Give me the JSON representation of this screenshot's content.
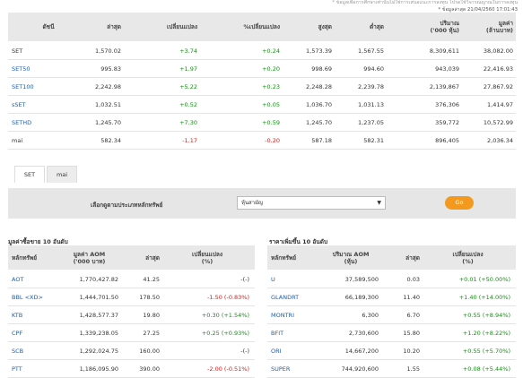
{
  "notes": {
    "line1": "* ข้อมูลเพื่อการศึกษาเท่านั้นไม่ใช่การเสนอแนะการลงทุน โปรดใช้วิจารณญาณในการลงทุน",
    "line2": "* ข้อมูลล่าสุด 21/04/2560 17:01:43"
  },
  "index_table": {
    "headers": [
      "ดัชนี",
      "ล่าสุด",
      "เปลี่ยนแปลง",
      "%เปลี่ยนแปลง",
      "สูงสุด",
      "ต่ำสุด",
      "ปริมาณ\n('000 หุ้น)",
      "มูลค่า\n(ล้านบาท)"
    ],
    "rows": [
      {
        "name": "SET",
        "last": "1,570.02",
        "chg": "+3.74",
        "pct": "+0.24",
        "high": "1,573.39",
        "low": "1,567.55",
        "vol": "8,309,611",
        "val": "38,082.00",
        "dir": "up",
        "link": false
      },
      {
        "name": "SET50",
        "last": "995.83",
        "chg": "+1.97",
        "pct": "+0.20",
        "high": "998.69",
        "low": "994.60",
        "vol": "943,039",
        "val": "22,416.93",
        "dir": "up",
        "link": true
      },
      {
        "name": "SET100",
        "last": "2,242.98",
        "chg": "+5.22",
        "pct": "+0.23",
        "high": "2,248.28",
        "low": "2,239.78",
        "vol": "2,139,867",
        "val": "27,867.92",
        "dir": "up",
        "link": true
      },
      {
        "name": "sSET",
        "last": "1,032.51",
        "chg": "+0.52",
        "pct": "+0.05",
        "high": "1,036.70",
        "low": "1,031.13",
        "vol": "376,306",
        "val": "1,414.97",
        "dir": "up",
        "link": true
      },
      {
        "name": "SETHD",
        "last": "1,245.70",
        "chg": "+7.30",
        "pct": "+0.59",
        "high": "1,245.70",
        "low": "1,237.05",
        "vol": "359,772",
        "val": "10,572.99",
        "dir": "up",
        "link": true
      },
      {
        "name": "mai",
        "last": "582.34",
        "chg": "-1.17",
        "pct": "-0.20",
        "high": "587.18",
        "low": "582.31",
        "vol": "896,405",
        "val": "2,036.34",
        "dir": "down",
        "link": false
      }
    ]
  },
  "tabs": [
    "SET",
    "mai"
  ],
  "filter": {
    "label": "เลือกดูตามประเภทหลักทรัพย์",
    "selected": "หุ้นสามัญ",
    "go": "Go"
  },
  "top_value": {
    "title": "มูลค่าซื้อขาย 10 อันดับ",
    "headers": [
      "หลักทรัพย์",
      "มูลค่า AOM\n('000 บาท)",
      "ล่าสุด",
      "เปลี่ยนแปลง\n(%)"
    ],
    "rows": [
      {
        "sym": "AOT",
        "val": "1,770,427.82",
        "last": "41.25",
        "chg": "-(-)",
        "dir": "none"
      },
      {
        "sym": "BBL <XD>",
        "val": "1,444,701.50",
        "last": "178.50",
        "chg": "-1.50 (-0.83%)",
        "dir": "down"
      },
      {
        "sym": "KTB",
        "val": "1,428,577.37",
        "last": "19.80",
        "chg": "+0.30 (+1.54%)",
        "dir": "up"
      },
      {
        "sym": "CPF",
        "val": "1,339,238.05",
        "last": "27.25",
        "chg": "+0.25 (+0.93%)",
        "dir": "up"
      },
      {
        "sym": "SCB",
        "val": "1,292,024.75",
        "last": "160.00",
        "chg": "-(-)",
        "dir": "none"
      },
      {
        "sym": "PTT",
        "val": "1,186,095.90",
        "last": "390.00",
        "chg": "-2.00 (-0.51%)",
        "dir": "down"
      }
    ]
  },
  "top_gain": {
    "title": "ราคาเพิ่มขึ้น 10 อันดับ",
    "headers": [
      "หลักทรัพย์",
      "ปริมาณ AOM\n(หุ้น)",
      "ล่าสุด",
      "เปลี่ยนแปลง\n(%)"
    ],
    "rows": [
      {
        "sym": "U",
        "vol": "37,589,500",
        "last": "0.03",
        "chg": "+0.01 (+50.00%)"
      },
      {
        "sym": "GLANDRT",
        "vol": "66,189,300",
        "last": "11.40",
        "chg": "+1.40 (+14.00%)"
      },
      {
        "sym": "MONTRI",
        "vol": "6,300",
        "last": "6.70",
        "chg": "+0.55 (+8.94%)"
      },
      {
        "sym": "BFIT",
        "vol": "2,730,600",
        "last": "15.80",
        "chg": "+1.20 (+8.22%)"
      },
      {
        "sym": "ORI",
        "vol": "14,667,200",
        "last": "10.20",
        "chg": "+0.55 (+5.70%)"
      },
      {
        "sym": "SUPER",
        "vol": "744,920,600",
        "last": "1.55",
        "chg": "+0.08 (+5.44%)"
      }
    ]
  },
  "colors": {
    "up": "#1a8a1a",
    "down": "#d32020",
    "link": "#1f5da8",
    "go": "#f39a1e"
  }
}
